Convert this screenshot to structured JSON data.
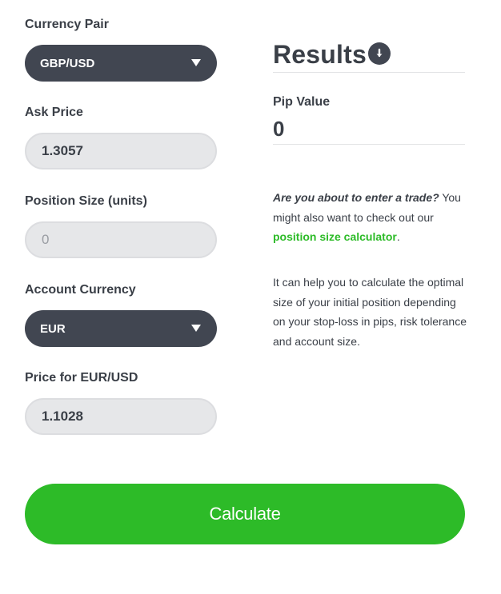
{
  "form": {
    "currency_pair": {
      "label": "Currency Pair",
      "value": "GBP/USD"
    },
    "ask_price": {
      "label": "Ask Price",
      "value": "1.3057"
    },
    "position_size": {
      "label": "Position Size (units)",
      "placeholder": "0"
    },
    "account_currency": {
      "label": "Account Currency",
      "value": "EUR"
    },
    "conversion_price": {
      "label": "Price for EUR/USD",
      "value": "1.1028"
    }
  },
  "results": {
    "title": "Results",
    "icon": "arrow-down-circle-icon",
    "pip_value_label": "Pip Value",
    "pip_value": "0"
  },
  "info": {
    "question": "Are you about to enter a trade?",
    "text_1": " You might also want to check out our ",
    "link_text": "position size calculator",
    "text_2": ".",
    "paragraph_2": "It can help you to calculate the optimal size of your initial position depending on your stop-loss in pips, risk tolerance and account size."
  },
  "actions": {
    "calculate_label": "Calculate"
  },
  "colors": {
    "accent": "#2dbb28",
    "dark": "#414651",
    "input_bg": "#e6e7e9",
    "text": "#3a3f47"
  }
}
